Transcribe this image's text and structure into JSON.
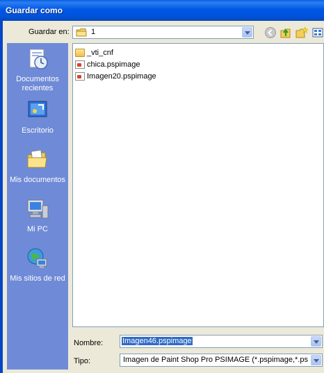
{
  "window": {
    "title": "Guardar como"
  },
  "toolbar": {
    "save_in_label": "Guardar en:",
    "save_in_value": "1"
  },
  "places": [
    {
      "label": "Documentos recientes",
      "icon": "recent-documents-icon"
    },
    {
      "label": "Escritorio",
      "icon": "desktop-icon"
    },
    {
      "label": "Mis documentos",
      "icon": "my-documents-icon"
    },
    {
      "label": "Mi PC",
      "icon": "my-computer-icon"
    },
    {
      "label": "Mis sitios de red",
      "icon": "network-places-icon"
    }
  ],
  "files": [
    {
      "name": "_vti_cnf",
      "type": "folder"
    },
    {
      "name": "chica.pspimage",
      "type": "pspimage"
    },
    {
      "name": "Imagen20.pspimage",
      "type": "pspimage"
    }
  ],
  "form": {
    "name_label": "Nombre:",
    "name_value": "Imagen46.pspimage",
    "type_label": "Tipo:",
    "type_value": "Imagen de Paint Shop Pro PSIMAGE (*.pspimage,*.psp,*"
  },
  "colors": {
    "title_bar": "#0058E6",
    "places_bar": "#6F8BD7",
    "selection": "#316AC5",
    "dialog_bg": "#ECE9D8"
  }
}
